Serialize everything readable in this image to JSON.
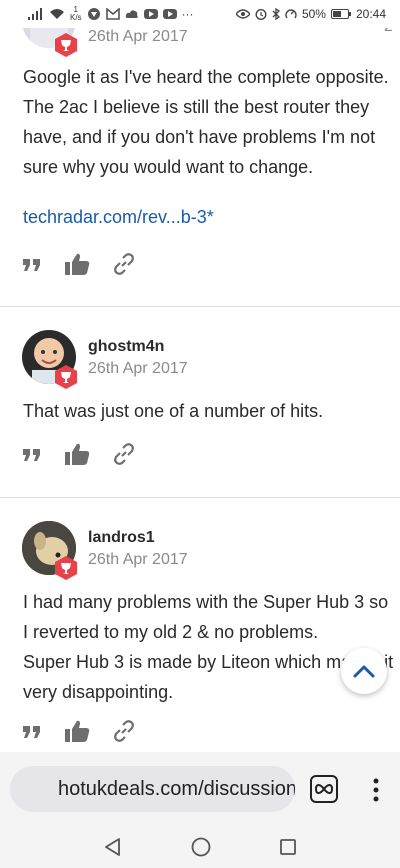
{
  "status_bar": {
    "net_speed_value": "1",
    "net_speed_unit": "K/s",
    "battery": "50%",
    "time": "20:44",
    "overflow": "···"
  },
  "comments": [
    {
      "date": "26th Apr 2017",
      "lines": [
        "Google it as I've heard the complete opposite.",
        "The 2ac I believe is still the best router they",
        "have, and if you don't have problems I'm not",
        "sure why you would want to change."
      ],
      "link": "techradar.com/rev...b-3",
      "link_mark": "*",
      "corner_count": "2"
    },
    {
      "username": "ghostm4n",
      "date": "26th Apr 2017",
      "lines": [
        "That was just one of a number of hits."
      ]
    },
    {
      "username": "landros1",
      "date": "26th Apr 2017",
      "lines": [
        "I had many problems with the Super Hub 3 so",
        "I reverted to my old 2 & no problems.",
        "Super Hub 3 is made by Liteon which makes it",
        "very disappointing."
      ]
    }
  ],
  "browser": {
    "url": "hotukdeals.com/discussions"
  },
  "colors": {
    "link": "#1a5aa8",
    "badge": "#e8414a",
    "date": "#8a8a8a"
  }
}
